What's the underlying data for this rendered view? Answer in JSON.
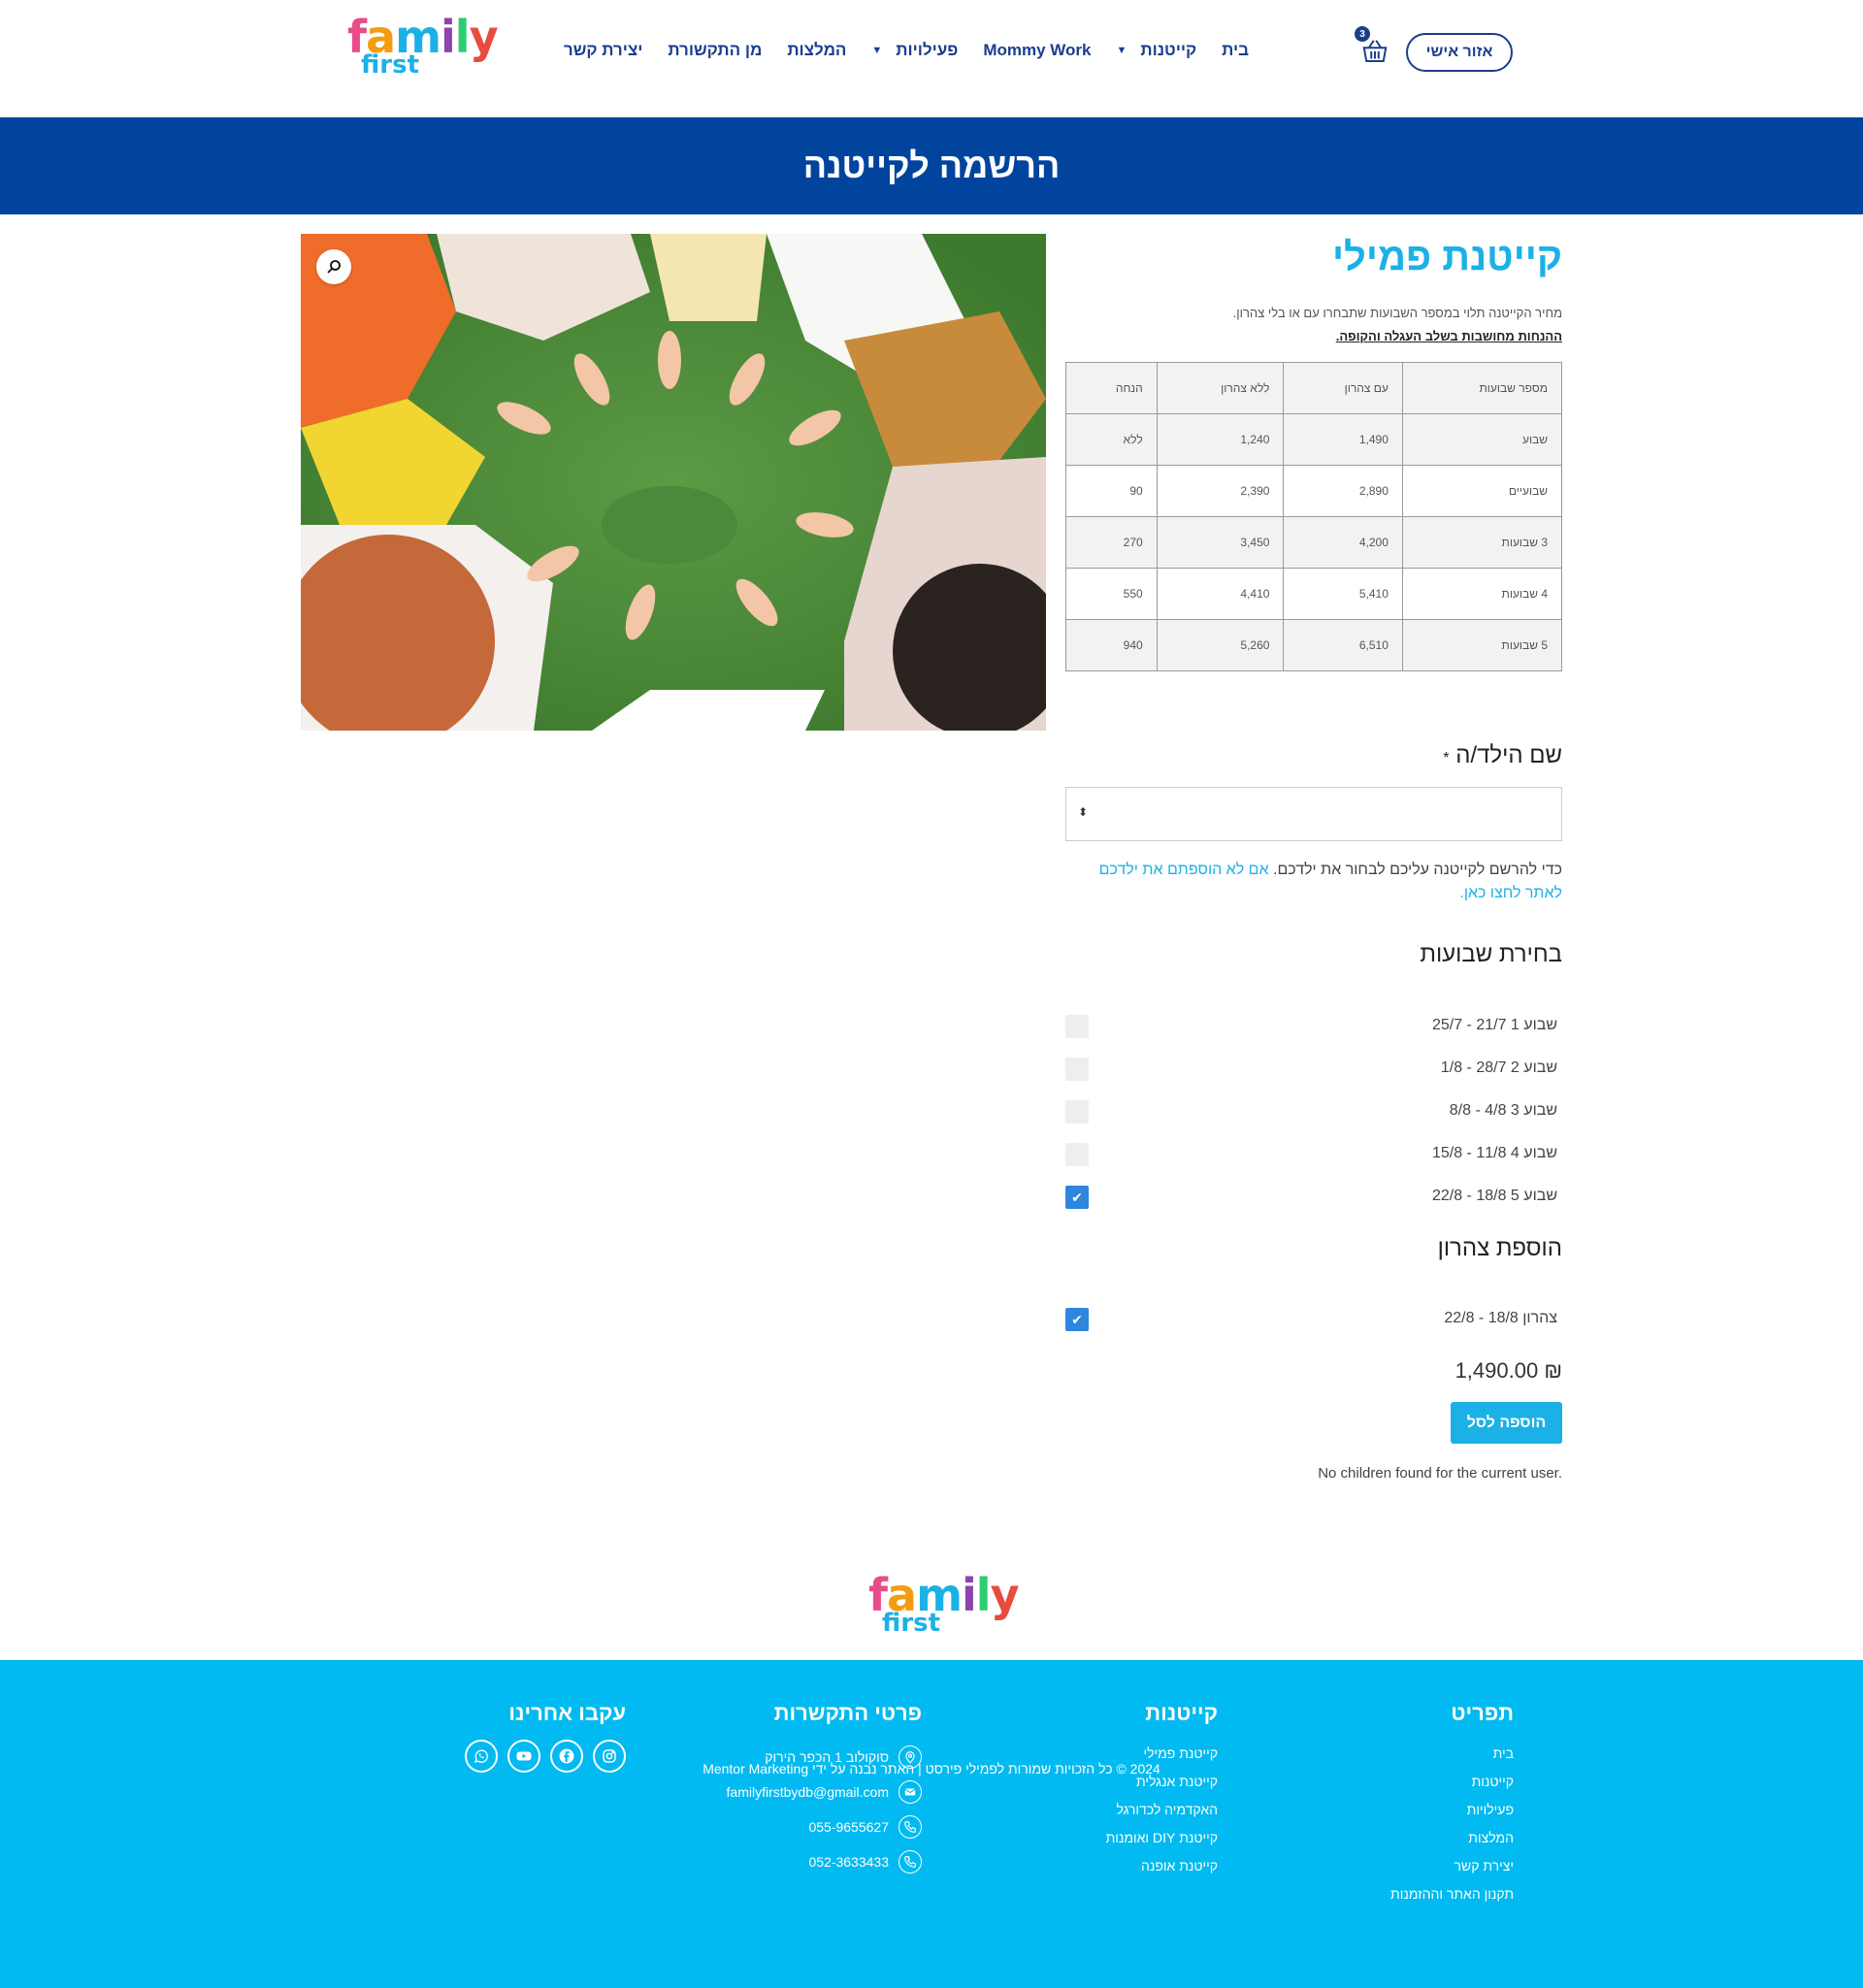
{
  "header": {
    "logo_word1": "family",
    "logo_word2": "first",
    "nav": [
      {
        "label": "בית",
        "has_caret": false
      },
      {
        "label": "קייטנות",
        "has_caret": true
      },
      {
        "label": "Mommy Work",
        "has_caret": false
      },
      {
        "label": "פעילויות",
        "has_caret": true
      },
      {
        "label": "המלצות",
        "has_caret": false
      },
      {
        "label": "מן התקשורת",
        "has_caret": false
      },
      {
        "label": "יצירת קשר",
        "has_caret": false
      }
    ],
    "account_label": "אזור אישי",
    "cart_count": "3",
    "cart_icon": "cart-icon"
  },
  "banner": {
    "title": "הרשמה לקייטנה"
  },
  "product": {
    "title": "קייטנת פמילי",
    "desc_line1": "מחיר הקייטנה תלוי במספר השבועות שתבחרו עם או בלי צהרון.",
    "desc_line2": "ההנחות מחושבות בשלב העגלה והקופה.",
    "image_alt": "children hands on grass",
    "zoom_icon": "magnifier-icon"
  },
  "price_table": {
    "headers": [
      "מספר שבועות",
      "עם צהרון",
      "ללא צהרון",
      "הנחה"
    ],
    "rows": [
      [
        "שבוע",
        "1,490",
        "1,240",
        "ללא"
      ],
      [
        "שבועיים",
        "2,890",
        "2,390",
        "90"
      ],
      [
        "3 שבועות",
        "4,200",
        "3,450",
        "270"
      ],
      [
        "4 שבועות",
        "5,410",
        "4,410",
        "550"
      ],
      [
        "5 שבועות",
        "6,510",
        "5,260",
        "940"
      ]
    ]
  },
  "child_field": {
    "label": "שם הילד/ה",
    "required_mark": "*",
    "note_text": "כדי להרשם לקייטנה עליכם לבחור את ילדכם. ",
    "note_link": "אם לא הוספתם את ילדכם לאתר לחצו כאן."
  },
  "weeks": {
    "title": "בחירת שבועות",
    "items": [
      {
        "label": "שבוע 1 21/7 - 25/7",
        "checked": false
      },
      {
        "label": "שבוע 2 28/7 - 1/8",
        "checked": false
      },
      {
        "label": "שבוע 3 4/8 - 8/8",
        "checked": false
      },
      {
        "label": "שבוע 4 11/8 - 15/8",
        "checked": false
      },
      {
        "label": "שבוע 5 18/8 - 22/8",
        "checked": true
      }
    ]
  },
  "afternoon": {
    "title": "הוספת צהרון",
    "items": [
      {
        "label": "צהרון 18/8 - 22/8",
        "checked": true
      }
    ]
  },
  "total_price": "₪ 1,490.00",
  "add_to_cart": "הוספה לסל",
  "no_children_msg": "No children found for the current user.",
  "footer": {
    "menu": {
      "title": "תפריט",
      "links": [
        "בית",
        "קייטנות",
        "פעילויות",
        "המלצות",
        "יצירת קשר",
        "תקנון האתר וההזמנות"
      ]
    },
    "camps": {
      "title": "קייטנות",
      "links": [
        "קייטנת פמילי",
        "קייטנת אנגלית",
        "האקדמיה לכדורגל",
        "קייטנת DIY ואומנות",
        "קייטנת אופנה"
      ]
    },
    "contact": {
      "title": "פרטי התקשרות",
      "items": [
        {
          "icon": "location-icon",
          "text": "סוקולוב 1 הכפר הירוק"
        },
        {
          "icon": "email-icon",
          "text": "familyfirstbydb@gmail.com"
        },
        {
          "icon": "phone-icon",
          "text": "055-9655627"
        },
        {
          "icon": "phone-icon",
          "text": "052-3633433"
        }
      ]
    },
    "social": {
      "title": "עקבו אחרינו",
      "icons": [
        "instagram-icon",
        "facebook-icon",
        "youtube-icon",
        "whatsapp-icon"
      ]
    },
    "copyright": "2024 © כל הזכויות שמורות לפמילי פירסט | האתר נבנה על ידי Mentor Marketing"
  },
  "colors": {
    "primary_blue": "#00449e",
    "accent_cyan": "#1cb1e6",
    "footer_bg": "#00baf1",
    "checkbox_blue": "#2e86de"
  }
}
